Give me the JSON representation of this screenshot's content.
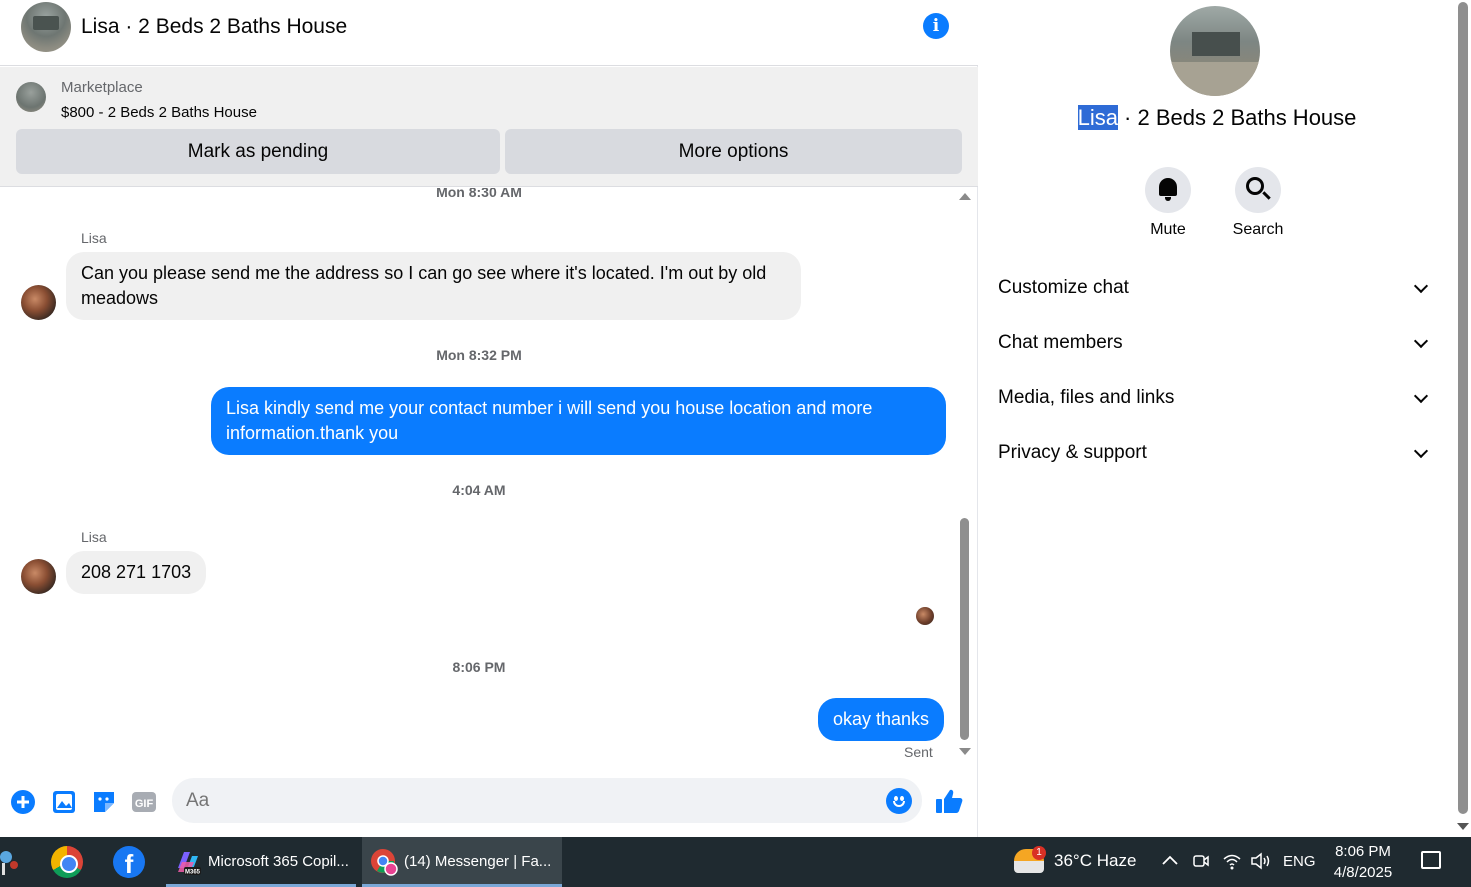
{
  "header": {
    "title": "Lisa · 2 Beds 2 Baths House"
  },
  "marketplace": {
    "label": "Marketplace",
    "listing": "$800 - 2 Beds 2 Baths House",
    "pending_button": "Mark as pending",
    "more_button": "More options"
  },
  "messages": {
    "timestamps": [
      "Mon 8:30 AM",
      "Mon 8:32 PM",
      "4:04 AM",
      "8:06 PM"
    ],
    "items": [
      {
        "sender": "Lisa",
        "text": "Can you please send me the address so I can go see where it's located. I'm out by old meadows",
        "direction": "in"
      },
      {
        "sender": "",
        "text": "Lisa kindly send me your contact number i will send you house location and more information.thank you",
        "direction": "out"
      },
      {
        "sender": "Lisa",
        "text": "208 271 1703",
        "direction": "in"
      },
      {
        "sender": "",
        "text": "okay thanks",
        "direction": "out"
      }
    ],
    "status": "Sent"
  },
  "composer": {
    "placeholder": "Aa",
    "gif_label": "GIF"
  },
  "panel": {
    "name_highlight": "Lisa",
    "name_rest": " · 2 Beds 2 Baths House",
    "actions": [
      "Mute",
      "Search"
    ],
    "sections": [
      "Customize chat",
      "Chat members",
      "Media, files and links",
      "Privacy & support"
    ]
  },
  "taskbar": {
    "apps": [
      "Microsoft 365 Copil...",
      "(14) Messenger | Fa..."
    ],
    "copilot_badge": "M365",
    "weather_badge": "1",
    "weather": "36°C  Haze",
    "language": "ENG",
    "time": "8:06 PM",
    "date": "4/8/2025"
  },
  "colors": {
    "accent": "#0a7cff",
    "selection": "#2e6bd6",
    "taskbar": "#1f2a30"
  }
}
